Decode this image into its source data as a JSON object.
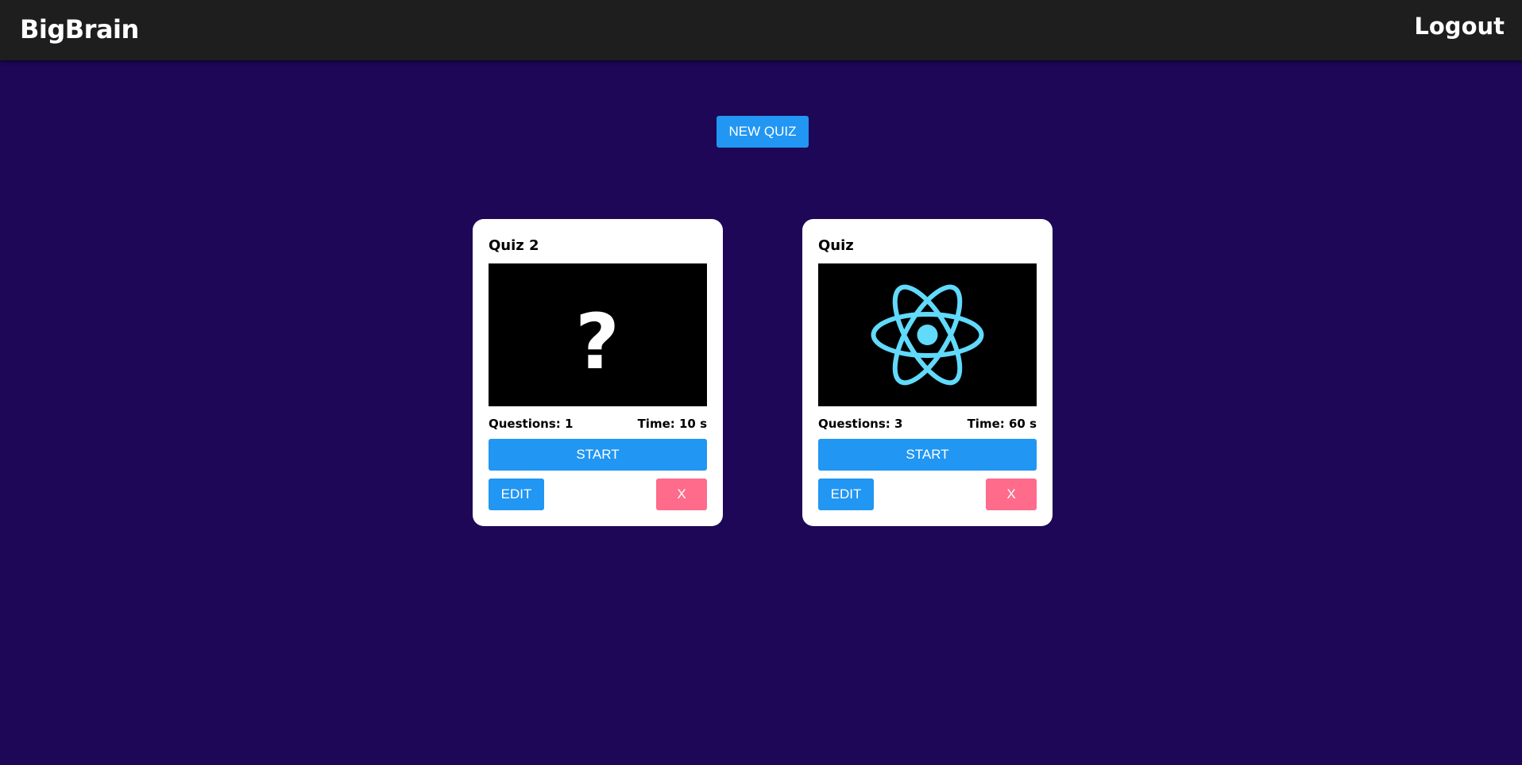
{
  "header": {
    "brand": "BigBrain",
    "logout_label": "Logout"
  },
  "toolbar": {
    "new_quiz_label": "NEW QUIZ"
  },
  "quizzes": [
    {
      "title": "Quiz 2",
      "thumbnail": "question-mark-icon",
      "questions_text": "Questions: 1",
      "time_text": "Time: 10 s",
      "start_label": "START",
      "edit_label": "EDIT",
      "delete_label": "X"
    },
    {
      "title": "Quiz",
      "thumbnail": "react-atom-icon",
      "questions_text": "Questions: 3",
      "time_text": "Time: 60 s",
      "start_label": "START",
      "edit_label": "EDIT",
      "delete_label": "X"
    }
  ],
  "colors": {
    "background": "#1d0756",
    "topbar": "#1e1e1e",
    "primary": "#2196f3",
    "danger": "#ff6b8b",
    "react_logo": "#61dafb"
  }
}
